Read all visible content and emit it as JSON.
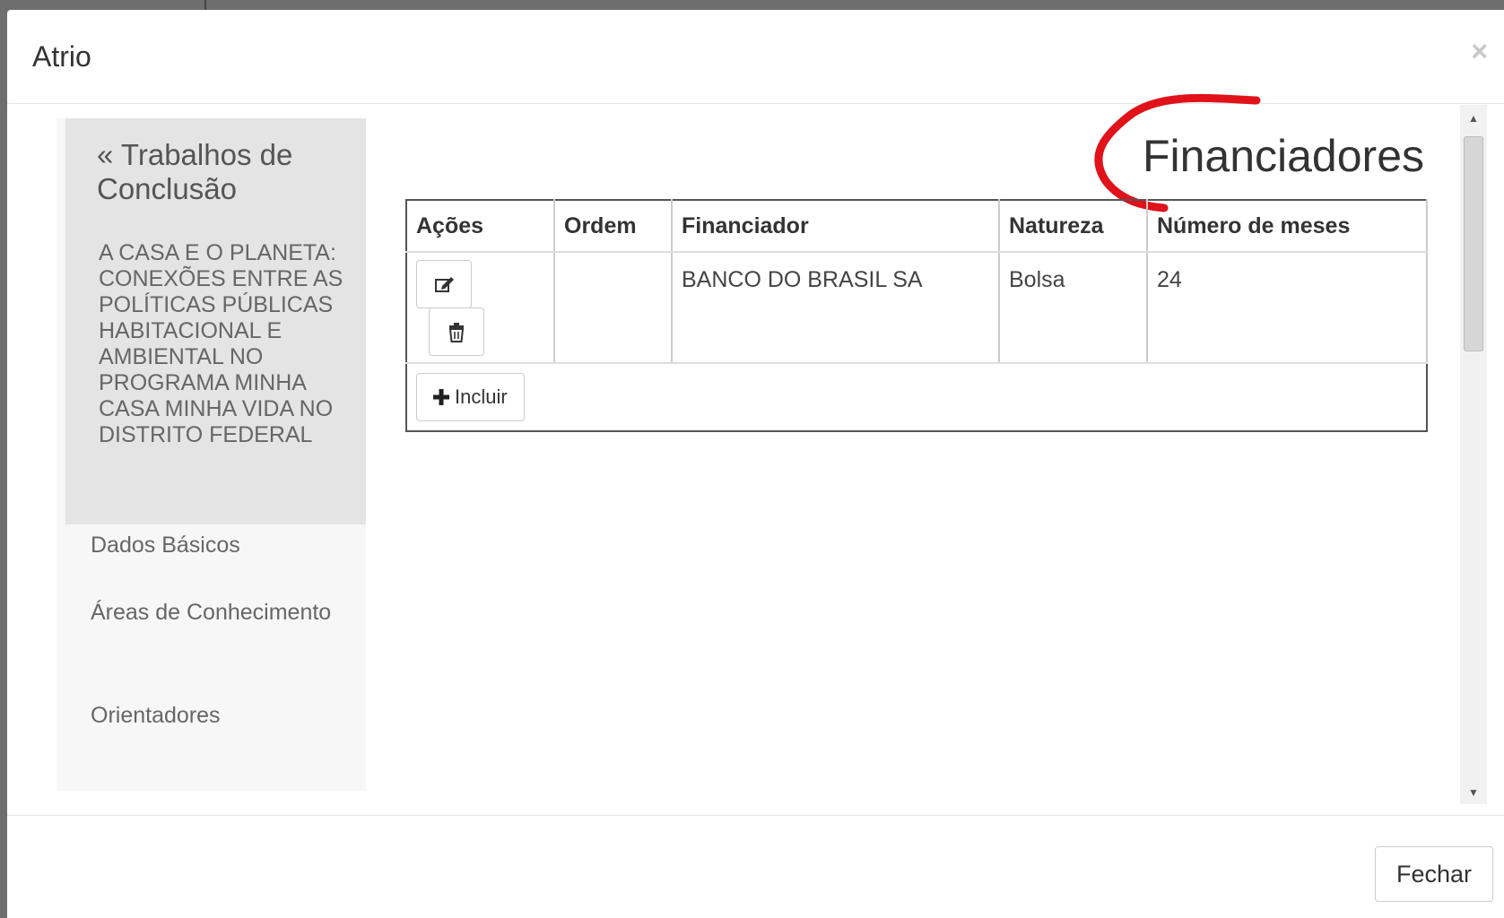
{
  "modal": {
    "title": "Atrio",
    "close_glyph": "×"
  },
  "sidebar": {
    "back_label": "« Trabalhos de Conclusão",
    "work_title": "A CASA E O PLANETA: CONEXÕES ENTRE AS POLÍTICAS PÚBLICAS HABITACIONAL E AMBIENTAL NO PROGRAMA MINHA CASA MINHA VIDA NO DISTRITO FEDERAL",
    "items": [
      {
        "label": "Dados Básicos"
      },
      {
        "label": "Áreas de Conhecimento"
      },
      {
        "label": "Orientadores"
      }
    ]
  },
  "main": {
    "section_title": "Financiadores",
    "annotation_color": "#e0121a",
    "table": {
      "headers": [
        "Ações",
        "Ordem",
        "Financiador",
        "Natureza",
        "Número de meses"
      ],
      "rows": [
        {
          "ordem": "",
          "financiador": "BANCO DO BRASIL SA",
          "natureza": "Bolsa",
          "meses": "24"
        }
      ]
    },
    "row_actions": [
      "edit-icon",
      "trash-icon"
    ],
    "add_button": {
      "icon": "plus-icon",
      "label": "Incluir"
    }
  },
  "footer": {
    "close_label": "Fechar"
  }
}
